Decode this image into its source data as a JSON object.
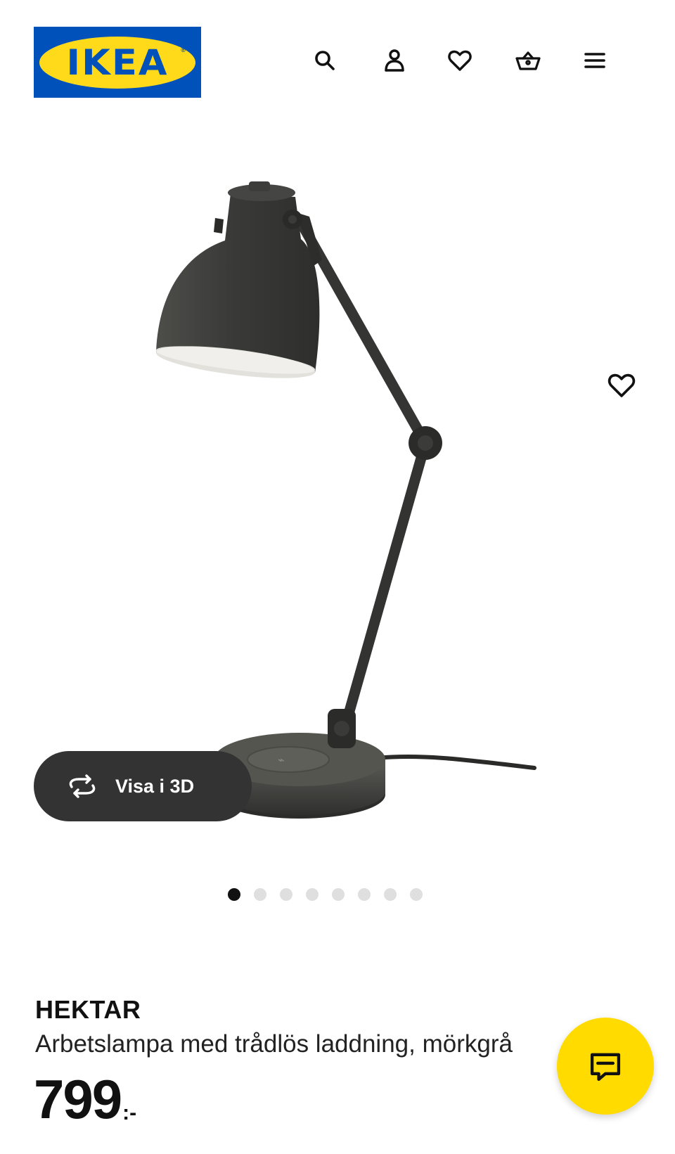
{
  "header": {
    "logo_text": "IKEA",
    "logo_reg": "®",
    "icons": [
      "search-icon",
      "account-icon",
      "heart-icon",
      "basket-icon",
      "menu-icon"
    ]
  },
  "gallery": {
    "view_3d_label": "Visa i 3D",
    "dot_count": 8,
    "active_dot": 1
  },
  "product": {
    "name": "HEKTAR",
    "description": "Arbetslampa med trådlös laddning, mörkgrå",
    "price_integer": "799",
    "price_suffix": ":-"
  },
  "colors": {
    "ikea_blue": "#0051ba",
    "ikea_yellow": "#ffda1a",
    "chat_yellow": "#ffdb00",
    "pill_bg": "#333333",
    "lamp": "#3d3d3b"
  }
}
